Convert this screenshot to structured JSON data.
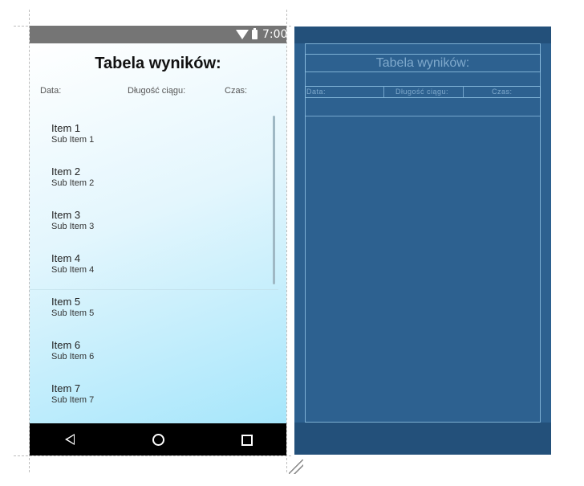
{
  "status_bar": {
    "time": "7:00"
  },
  "screen": {
    "title": "Tabela wyników:",
    "columns": [
      "Data:",
      "Długość ciągu:",
      "Czas:"
    ],
    "items": [
      {
        "title": "Item 1",
        "subtitle": "Sub Item 1"
      },
      {
        "title": "Item 2",
        "subtitle": "Sub Item 2"
      },
      {
        "title": "Item 3",
        "subtitle": "Sub Item 3"
      },
      {
        "title": "Item 4",
        "subtitle": "Sub Item 4"
      },
      {
        "title": "Item 5",
        "subtitle": "Sub Item 5"
      },
      {
        "title": "Item 6",
        "subtitle": "Sub Item 6"
      },
      {
        "title": "Item 7",
        "subtitle": "Sub Item 7"
      }
    ]
  },
  "blueprint": {
    "title": "Tabela wyników:",
    "columns": [
      "Data:",
      "Długość ciągu:",
      "Czas:"
    ]
  },
  "colors": {
    "status_bar": "#757575",
    "nav_bar": "#000000",
    "gradient_end": "#a6e6fb",
    "blueprint_bg": "#2d6190",
    "blueprint_bar": "#23507a"
  },
  "icons": [
    "wifi-icon",
    "battery-icon",
    "back-icon",
    "home-icon",
    "recent-apps-icon",
    "resize-handle-icon"
  ]
}
